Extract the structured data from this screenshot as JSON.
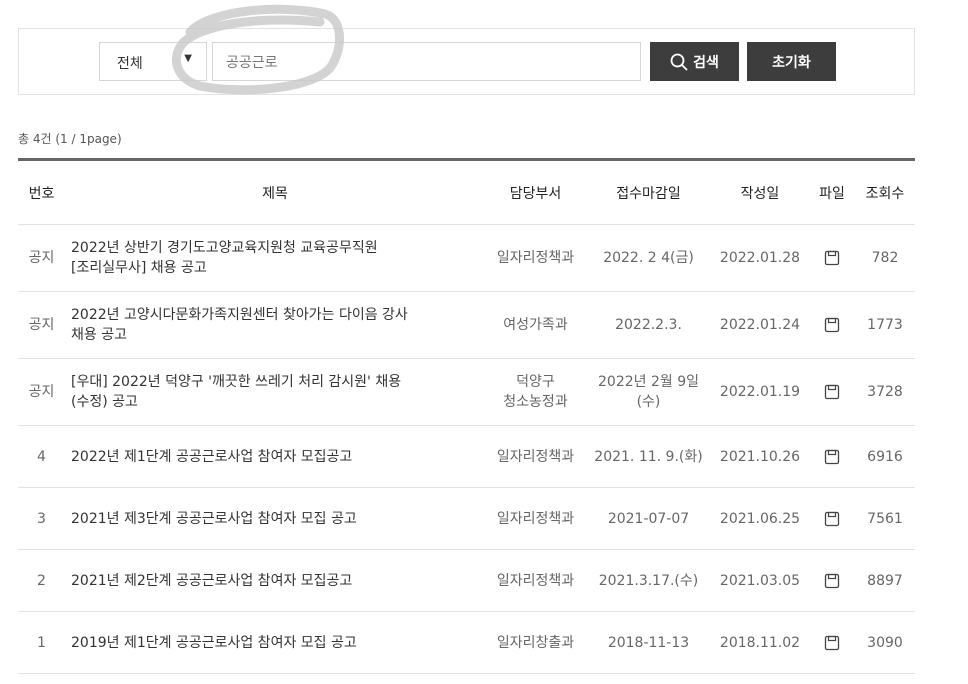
{
  "search": {
    "category": "전체",
    "keyword": "공공근로",
    "search_label": "검색",
    "reset_label": "초기화"
  },
  "summary": "총 4건 (1 / 1page)",
  "columns": {
    "no": "번호",
    "title": "제목",
    "dept": "담당부서",
    "deadline": "접수마감일",
    "date": "작성일",
    "file": "파일",
    "views": "조회수"
  },
  "rows": [
    {
      "no": "공지",
      "title_line1": "2022년 상반기 경기도고양교육지원청 교육공무직원",
      "title_line2": "[조리실무사] 채용 공고",
      "dept_line1": "일자리정책과",
      "dept_line2": "",
      "deadline_line1": "2022. 2 4(금)",
      "deadline_line2": "",
      "date": "2022.01.28",
      "file": "file-icon",
      "views": "782"
    },
    {
      "no": "공지",
      "title_line1": "2022년 고양시다문화가족지원센터 찾아가는 다이음 강사",
      "title_line2": "채용 공고",
      "dept_line1": "여성가족과",
      "dept_line2": "",
      "deadline_line1": "2022.2.3.",
      "deadline_line2": "",
      "date": "2022.01.24",
      "file": "file-icon",
      "views": "1773"
    },
    {
      "no": "공지",
      "title_line1": "[우대] 2022년 덕양구 '깨끗한 쓰레기 처리 감시원' 채용",
      "title_line2": "(수정) 공고",
      "dept_line1": "덕양구",
      "dept_line2": "청소농정과",
      "deadline_line1": "2022년 2월 9일",
      "deadline_line2": "(수)",
      "date": "2022.01.19",
      "file": "file-icon",
      "views": "3728"
    },
    {
      "no": "4",
      "title_line1": "2022년 제1단계 공공근로사업 참여자 모집공고",
      "title_line2": "",
      "dept_line1": "일자리정책과",
      "dept_line2": "",
      "deadline_line1": "2021. 11. 9.(화)",
      "deadline_line2": "",
      "date": "2021.10.26",
      "file": "file-icon",
      "views": "6916"
    },
    {
      "no": "3",
      "title_line1": "2021년 제3단계 공공근로사업 참여자 모집 공고",
      "title_line2": "",
      "dept_line1": "일자리정책과",
      "dept_line2": "",
      "deadline_line1": "2021-07-07",
      "deadline_line2": "",
      "date": "2021.06.25",
      "file": "file-icon",
      "views": "7561"
    },
    {
      "no": "2",
      "title_line1": "2021년 제2단계 공공근로사업 참여자 모집공고",
      "title_line2": "",
      "dept_line1": "일자리정책과",
      "dept_line2": "",
      "deadline_line1": "2021.3.17.(수)",
      "deadline_line2": "",
      "date": "2021.03.05",
      "file": "file-icon",
      "views": "8897"
    },
    {
      "no": "1",
      "title_line1": "2019년 제1단계 공공근로사업 참여자 모집 공고",
      "title_line2": "",
      "dept_line1": "일자리창출과",
      "dept_line2": "",
      "deadline_line1": "2018-11-13",
      "deadline_line2": "",
      "date": "2018.11.02",
      "file": "file-icon",
      "views": "3090"
    }
  ]
}
